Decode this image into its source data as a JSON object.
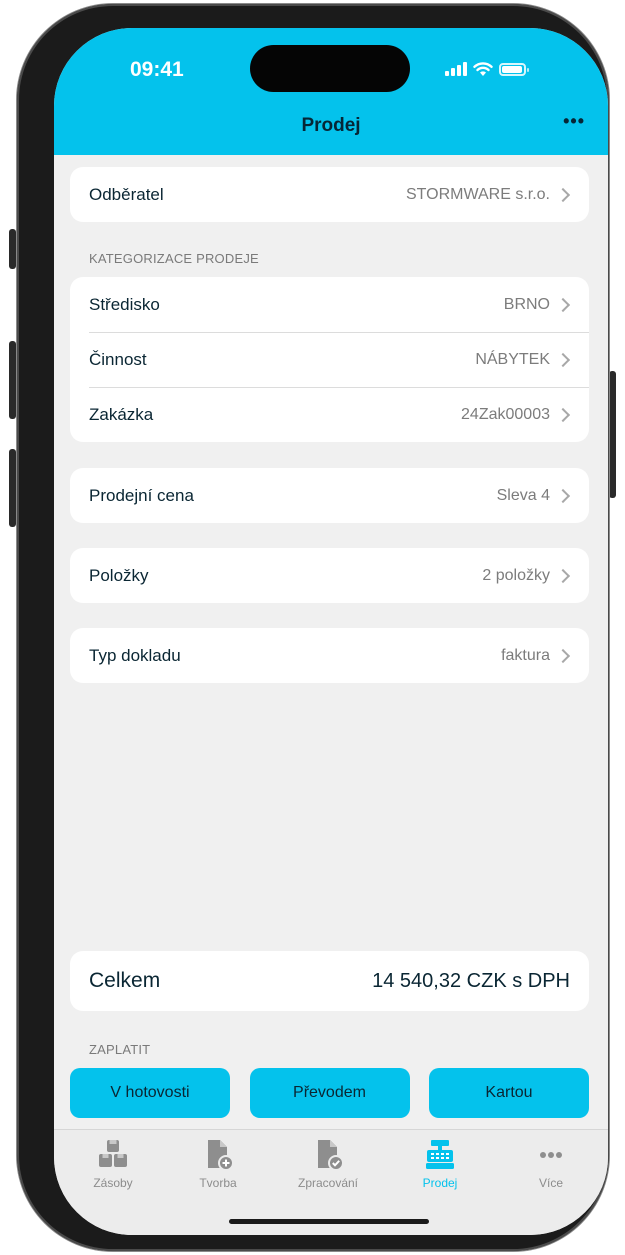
{
  "status": {
    "time": "09:41"
  },
  "header": {
    "title": "Prodej",
    "more_label": "•••"
  },
  "odberatel": {
    "label": "Odběratel",
    "value": "STORMWARE s.r.o."
  },
  "kategorizace": {
    "header": "KATEGORIZACE PRODEJE",
    "items": [
      {
        "label": "Středisko",
        "value": "BRNO"
      },
      {
        "label": "Činnost",
        "value": "NÁBYTEK"
      },
      {
        "label": "Zakázka",
        "value": "24Zak00003"
      }
    ]
  },
  "prodejni_cena": {
    "label": "Prodejní cena",
    "value": "Sleva 4"
  },
  "polozky": {
    "label": "Položky",
    "value": "2 položky"
  },
  "typ_dokladu": {
    "label": "Typ dokladu",
    "value": "faktura"
  },
  "total": {
    "label": "Celkem",
    "value": "14 540,32 CZK s DPH"
  },
  "payment": {
    "header": "ZAPLATIT",
    "buttons": [
      "V hotovosti",
      "Převodem",
      "Kartou"
    ]
  },
  "tabs": [
    {
      "label": "Zásoby",
      "icon": "boxes-icon",
      "active": false
    },
    {
      "label": "Tvorba",
      "icon": "document-add-icon",
      "active": false
    },
    {
      "label": "Zpracování",
      "icon": "document-check-icon",
      "active": false
    },
    {
      "label": "Prodej",
      "icon": "cash-register-icon",
      "active": true
    },
    {
      "label": "Více",
      "icon": "more-icon",
      "active": false
    }
  ],
  "colors": {
    "accent": "#04c2ec",
    "background": "#f0f0f0",
    "text": "#0a2633",
    "muted": "#7c7c7c"
  }
}
